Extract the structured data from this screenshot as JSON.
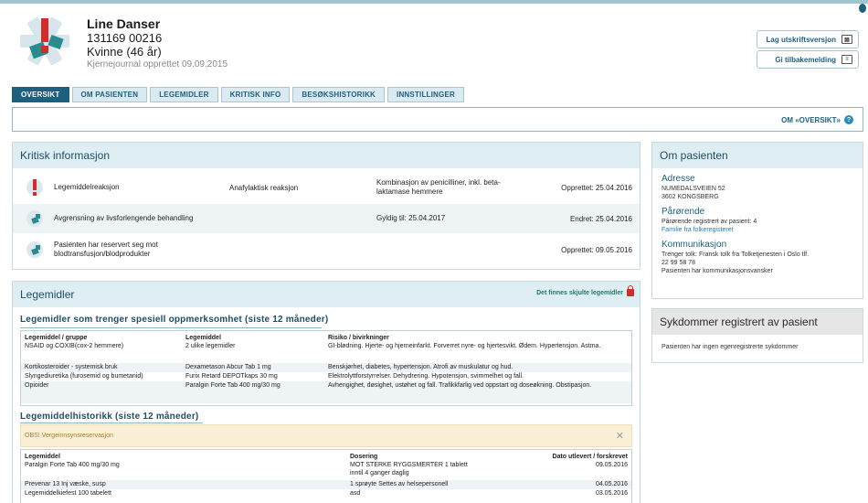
{
  "header": {
    "name": "Line Danser",
    "id_number": "131169 00216",
    "gender_age": "Kvinne (46 år)",
    "created": "Kjernejournal opprettet 09.09.2015",
    "print_label": "Lag utskriftsversjon",
    "feedback_label": "Gi tilbakemelding"
  },
  "tabs": [
    "OVERSIKT",
    "OM PASIENTEN",
    "LEGEMIDLER",
    "KRITISK INFO",
    "BESØKSHISTORIKK",
    "INNSTILLINGER"
  ],
  "overview_help": "OM «OVERSIKT»",
  "critical": {
    "title": "Kritisk informasjon",
    "rows": [
      {
        "type": "Legemiddelreaksjon",
        "detail": "Anafylaktisk reaksjon",
        "extra": "Kombinasjon av penicilliner, inkl. beta-laktamase hemmere",
        "date": "Opprettet: 25.04.2016",
        "icon": "warning-icon"
      },
      {
        "type": "Avgrensning av livsforlengende behandling",
        "detail": "",
        "extra": "Gyldig til: 25.04.2017",
        "date": "Endret: 25.04.2016",
        "icon": "info-icon"
      },
      {
        "type": "Pasienten har reservert seg mot blodtransfusjon/blodprodukter",
        "detail": "",
        "extra": "",
        "date": "Opprettet: 09.05.2016",
        "icon": "info-icon"
      }
    ]
  },
  "about": {
    "title": "Om pasienten",
    "address_h": "Adresse",
    "address_1": "NUMEDALSVEIEN 52",
    "address_2": "3602 KONGSBERG",
    "relatives_h": "Pårørende",
    "relatives_t": "Pårørende registrert av pasient: 4",
    "relatives_link": "Familie fra folkeregisteret",
    "comm_h": "Kommunikasjon",
    "comm_1": "Trenger tolk: Fransk tolk fra Tolketjenesten i Oslo tlf.",
    "comm_2": "22 99 58 78",
    "comm_3": "Pasienten har kommunikasjonsvansker"
  },
  "diseases": {
    "title": "Sykdommer registrert av pasient",
    "text": "Pasienten har ingen egenregistrerte sykdommer"
  },
  "meds": {
    "title": "Legemidler",
    "hidden_note": "Det finnes skjulte legemidler",
    "attention_title": "Legemidler som trenger spesiell oppmerksomhet (siste 12 måneder)",
    "attention_headers": [
      "Legemiddel / gruppe",
      "Legemiddel",
      "Risiko / bivirkninger"
    ],
    "attention_rows": [
      {
        "a": "NSAID og COXIB(cox-2 hemmere)",
        "b": "2 ulike legemidler",
        "c": "GI-blødning. Hjerte- og hjerneinfarkt. Forverret nyre- og hjertesvikt. Ødem. Hypertensjon. Astma."
      },
      {
        "a": "Kortikosteroider - systemisk bruk",
        "b": "Dexametason Abcur Tab 1 mg",
        "c": "Benskjørhet, diabetes, hypertensjon. Atrofi av muskulatur og hud."
      },
      {
        "a": "Slyngediuretika (furosemid og bumetanid)",
        "b": "Furix Retard DEPOTkaps 30 mg",
        "c": "Elektrolyttforstyrrelser. Dehydrering. Hypotensjon, svimmelhet og fall."
      },
      {
        "a": "Opioider",
        "b": "Paralgin Forte Tab 400 mg/30 mg",
        "c": "Avhengighet, døsighet, ustøhet og fall. Trafikkfarlig ved oppstart og doseøkning. Obstipasjon."
      }
    ],
    "history_title": "Legemiddelhistorikk (siste 12 måneder)",
    "reservation": "OBS! Vergeinnsynsreservasjon",
    "history_headers": [
      "Legemiddel",
      "Dosering",
      "Dato utlevert / forskrevet"
    ],
    "history_rows": [
      {
        "a": "Paralgin Forte Tab 400 mg/30 mg",
        "b": "MOT STERKE RYGGSMERTER 1 tablett",
        "c": "09.05.2016"
      },
      {
        "a": "",
        "b": "inntil 4 ganger daglig",
        "c": ""
      },
      {
        "a": "Prevenar 13 Inj væske, susp",
        "b": "1 sprøyte Settes av helsepersonell",
        "c": "04.05.2016"
      },
      {
        "a": "Legemiddelkiefest 100 tabelett",
        "b": "asd",
        "c": "03.05.2016"
      }
    ]
  },
  "colors": {
    "accent": "#1d5f7e",
    "panel_head": "#dfeef3",
    "warning": "#d62b2b",
    "reservation_bg": "#fbf0d7"
  }
}
